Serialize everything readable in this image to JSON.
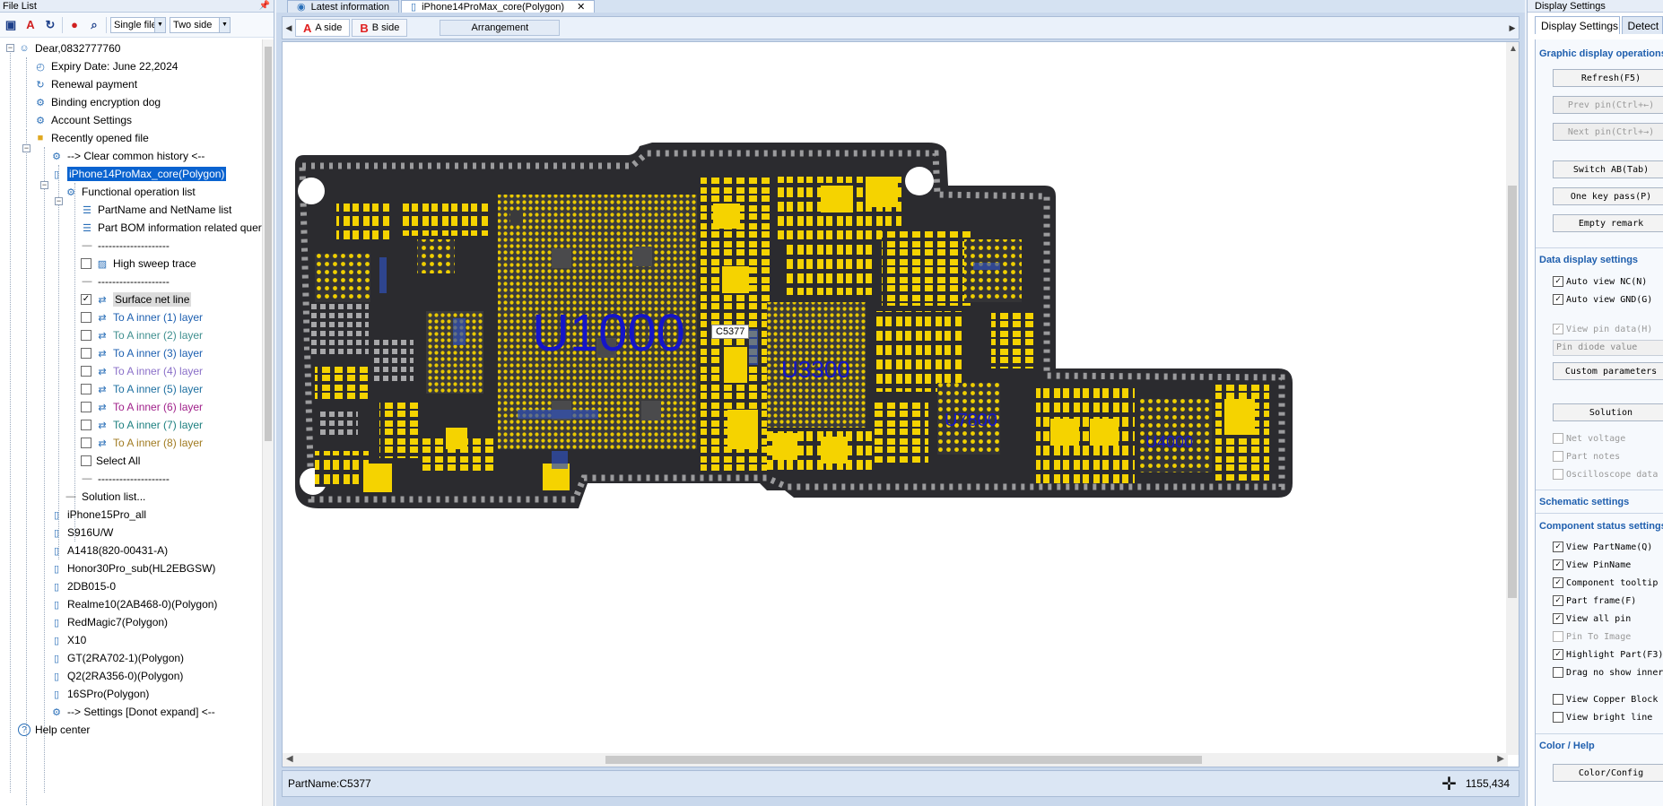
{
  "left_panel": {
    "title": "File List",
    "view_mode": "Single file",
    "side_mode": "Two side",
    "tree": [
      {
        "label": "Dear,0832777760",
        "icon": "user"
      },
      {
        "label": "Expiry Date: June 22,2024",
        "icon": "clock"
      },
      {
        "label": "Renewal payment",
        "icon": "refresh"
      },
      {
        "label": "Binding encryption dog",
        "icon": "gear"
      },
      {
        "label": "Account Settings",
        "icon": "gear"
      },
      {
        "label": "Recently opened file",
        "icon": "folder"
      },
      {
        "label": "--> Clear common history <--",
        "icon": "gear"
      },
      {
        "label": "iPhone14ProMax_core(Polygon)",
        "icon": "phone"
      },
      {
        "label": "Functional operation list",
        "icon": "gear"
      },
      {
        "label": "PartName and NetName list",
        "icon": "list"
      },
      {
        "label": "Part BOM information related query",
        "icon": "list"
      },
      {
        "label": "--------------------",
        "icon": "line"
      },
      {
        "label": "High sweep trace",
        "icon": "image"
      },
      {
        "label": "--------------------",
        "icon": "line"
      },
      {
        "label": "Surface net line",
        "icon": "net"
      },
      {
        "label": "To A inner (1) layer",
        "icon": "net",
        "color": "#1c5fb0"
      },
      {
        "label": "To A inner (2) layer",
        "icon": "net",
        "color": "#3f8f8f"
      },
      {
        "label": "To A inner (3) layer",
        "icon": "net",
        "color": "#1c5fb0"
      },
      {
        "label": "To A inner (4) layer",
        "icon": "net",
        "color": "#8a6fc8"
      },
      {
        "label": "To A inner (5) layer",
        "icon": "net",
        "color": "#1c6fa0"
      },
      {
        "label": "To A inner (6) layer",
        "icon": "net",
        "color": "#a0208a"
      },
      {
        "label": "To A inner (7) layer",
        "icon": "net",
        "color": "#1c7f7f"
      },
      {
        "label": "To A inner (8) layer",
        "icon": "net",
        "color": "#a07a20"
      },
      {
        "label": "Select All",
        "icon": "list"
      },
      {
        "label": "--------------------",
        "icon": "line"
      },
      {
        "label": "Solution list...",
        "icon": "line"
      },
      {
        "label": "iPhone15Pro_all",
        "icon": "phone"
      },
      {
        "label": "S916U/W",
        "icon": "phone"
      },
      {
        "label": "A1418(820-00431-A)",
        "icon": "phone"
      },
      {
        "label": "Honor30Pro_sub(HL2EBGSW)",
        "icon": "phone"
      },
      {
        "label": "2DB015-0",
        "icon": "phone"
      },
      {
        "label": "Realme10(2AB468-0)(Polygon)",
        "icon": "phone"
      },
      {
        "label": "RedMagic7(Polygon)",
        "icon": "phone"
      },
      {
        "label": "X10",
        "icon": "phone"
      },
      {
        "label": "GT(2RA702-1)(Polygon)",
        "icon": "phone"
      },
      {
        "label": "Q2(2RA356-0)(Polygon)",
        "icon": "phone"
      },
      {
        "label": "16SPro(Polygon)",
        "icon": "phone"
      },
      {
        "label": "--> Settings [Donot expand] <--",
        "icon": "gear"
      },
      {
        "label": "Help center",
        "icon": "help"
      }
    ]
  },
  "center": {
    "tabs": [
      {
        "label": "Latest information"
      },
      {
        "label": "iPhone14ProMax_core(Polygon)"
      }
    ],
    "side_tabs": [
      {
        "letter": "A",
        "label": "A side"
      },
      {
        "letter": "B",
        "label": "B side"
      }
    ],
    "arrangement_label": "Arrangement",
    "components": {
      "u1000": "U1000",
      "u3300": "U3300",
      "u7800": "U7800",
      "u4000": "U4000",
      "c5377": "C5377"
    },
    "status_part": "PartName:C5377",
    "status_coord": "1155,434"
  },
  "right_panel": {
    "title": "Display Settings",
    "tabs": [
      "Display Settings",
      "Detect"
    ],
    "graphic_header": "Graphic display operations",
    "refresh": "Refresh(F5)",
    "prev_pin": "Prev pin(Ctrl+←)",
    "next_pin": "Next pin(Ctrl+→)",
    "switch_ab": "Switch AB(Tab)",
    "one_key_pass": "One key pass(P)",
    "empty_remark": "Empty remark",
    "data_header": "Data display settings",
    "auto_nc": "Auto view NC(N)",
    "auto_gnd": "Auto view GND(G)",
    "view_pin_data": "View pin data(H)",
    "pin_diode": "Pin diode value",
    "custom_param": "Custom parameters",
    "solution": "Solution",
    "net_voltage": "Net voltage",
    "part_notes": "Part notes",
    "oscilloscope": "Oscilloscope data",
    "schematic_header": "Schematic settings",
    "component_header": "Component status settings",
    "view_partname": "View PartName(Q)",
    "view_pinname": "View PinName",
    "component_tooltip": "Component tooltip",
    "part_frame": "Part frame(F)",
    "view_all_pin": "View all pin",
    "pin_to_image": "Pin To Image",
    "highlight_part": "Highlight Part(F3)",
    "drag_no_show": "Drag no show inner",
    "view_copper": "View Copper Block",
    "view_bright": "View bright line",
    "color_header": "Color / Help",
    "color_config": "Color/Config"
  },
  "colors": {
    "accent": "#0a63d0",
    "board": "#2b2b2f",
    "pad": "#f5d300",
    "label": "#1515c8"
  }
}
